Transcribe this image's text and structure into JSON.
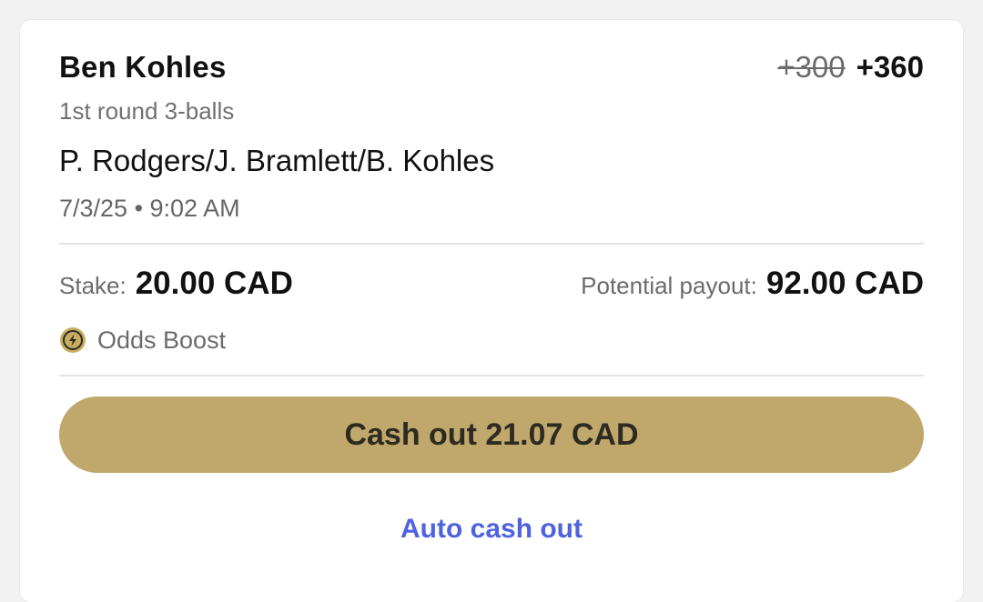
{
  "bet": {
    "selection": "Ben Kohles",
    "odds_old": "+300",
    "odds_new": "+360",
    "market": "1st round 3-balls",
    "event": "P. Rodgers/J. Bramlett/B. Kohles",
    "datetime": "7/3/25 • 9:02 AM"
  },
  "wager": {
    "stake_label": "Stake:",
    "stake_value": "20.00 CAD",
    "payout_label": "Potential payout:",
    "payout_value": "92.00 CAD"
  },
  "boost": {
    "icon": "lightning-coin-icon",
    "label": "Odds Boost"
  },
  "actions": {
    "cashout_label": "Cash out 21.07 CAD",
    "auto_cashout_label": "Auto cash out"
  },
  "colors": {
    "cashout_bg": "#c0a86d",
    "link": "#4d63df",
    "boost_icon": "#c9ad5f"
  }
}
